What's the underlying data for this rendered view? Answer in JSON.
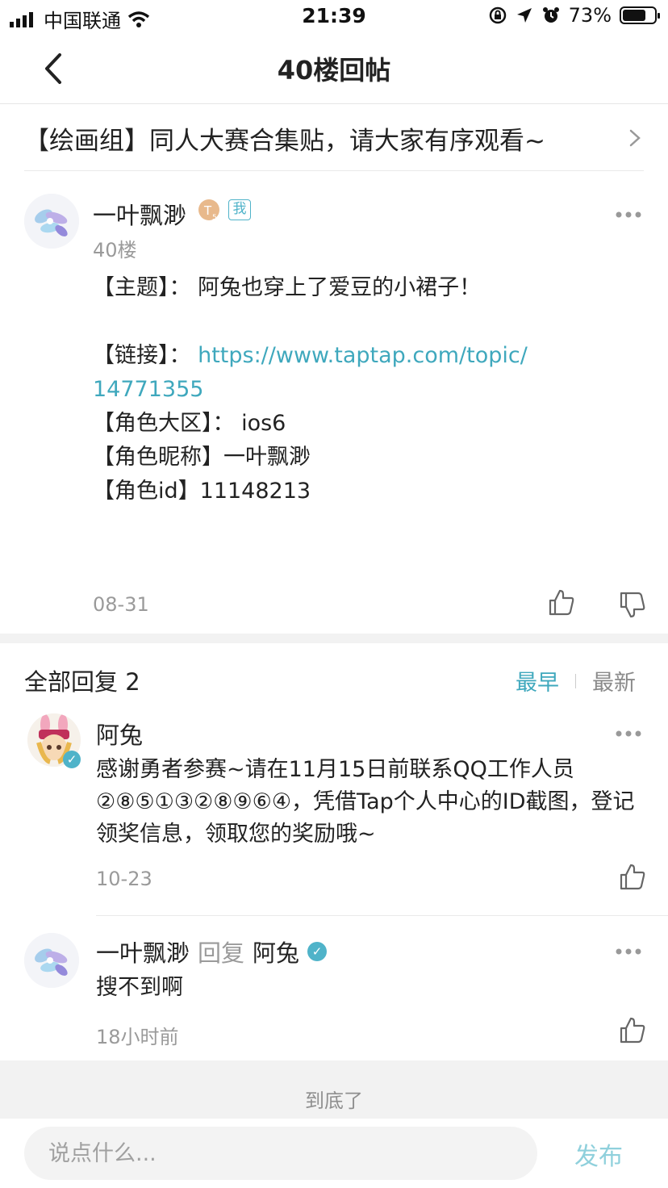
{
  "status_bar": {
    "carrier": "中国联通",
    "time": "21:39",
    "battery": "73%",
    "battery_level": 0.73
  },
  "nav": {
    "title": "40楼回帖"
  },
  "topic": {
    "title": "【绘画组】同人大赛合集贴，请大家有序观看~"
  },
  "post": {
    "author": "一叶飘渺",
    "badge_me": "我",
    "floor": "40楼",
    "lines": [
      "【主题】： 阿兔也穿上了爱豆的小裙子！",
      "",
      "【链接】： ",
      "【角色大区】： ios6",
      "【角色昵称】一叶飘渺",
      "【角色id】11148213"
    ],
    "link_part1": "https://www.taptap.com/topic/",
    "link_part2": "14771355",
    "time": "08-31"
  },
  "replies_header": {
    "title": "全部回复 2",
    "sort_earliest": "最早",
    "sort_newest": "最新",
    "active_color": "#3fa8bd"
  },
  "replies": [
    {
      "author": "阿兔",
      "text": "感谢勇者参赛~请在11月15日前联系QQ工作人员②⑧⑤①③②⑧⑨⑥④，凭借Tap个人中心的ID截图，登记领奖信息，领取您的奖励哦~",
      "time": "10-23"
    },
    {
      "author": "一叶飘渺",
      "reply_word": "回复",
      "reply_to": "阿兔",
      "text": "搜不到啊",
      "time": "18小时前"
    }
  ],
  "footer": {
    "end_text": "到底了",
    "input_placeholder": "说点什么...",
    "send_label": "发布"
  }
}
